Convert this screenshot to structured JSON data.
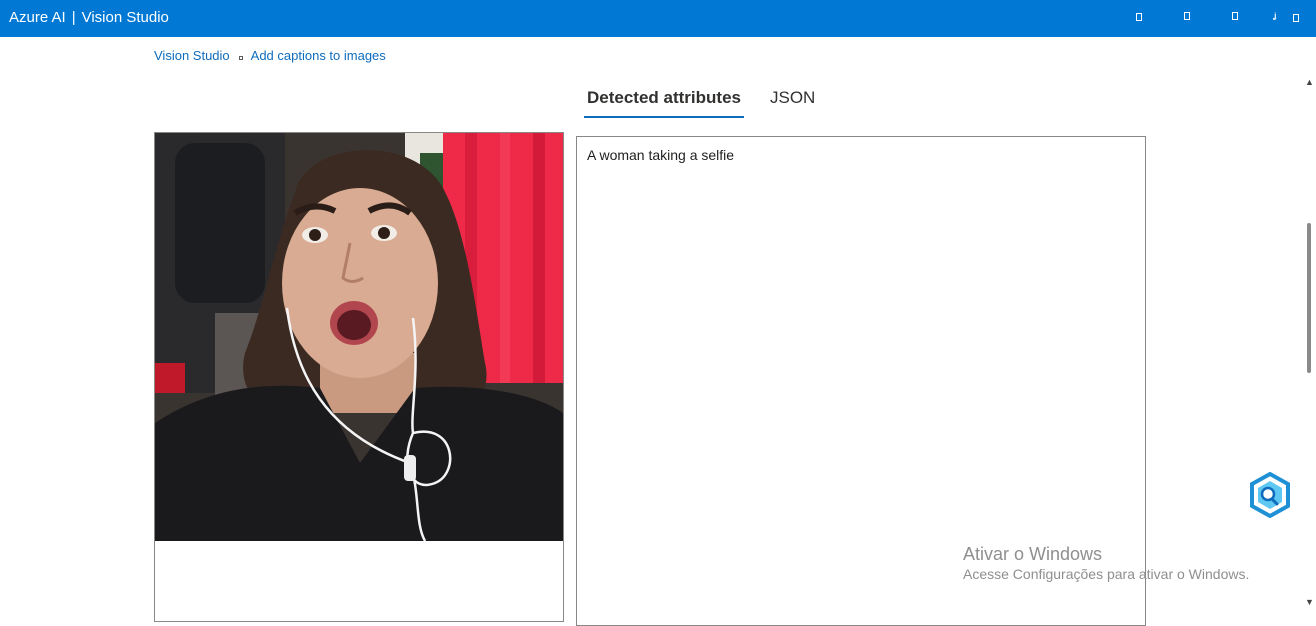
{
  "header": {
    "brand": "Azure AI",
    "separator": "|",
    "product": "Vision Studio",
    "icons": [
      "notifications-icon",
      "settings-icon",
      "help-icon",
      "feedback-icon",
      "account-icon"
    ]
  },
  "breadcrumb": {
    "home": "Vision Studio",
    "current": "Add captions to images"
  },
  "tabs": [
    {
      "label": "Detected attributes",
      "active": true
    },
    {
      "label": "JSON",
      "active": false
    }
  ],
  "results": {
    "caption": "A woman taking a selfie"
  },
  "watermark": {
    "title": "Ativar o Windows",
    "subtitle": "Acesse Configurações para ativar o Windows."
  },
  "colors": {
    "header_bg": "#0078d4",
    "link": "#0f6cbd",
    "border": "#8a8886"
  }
}
